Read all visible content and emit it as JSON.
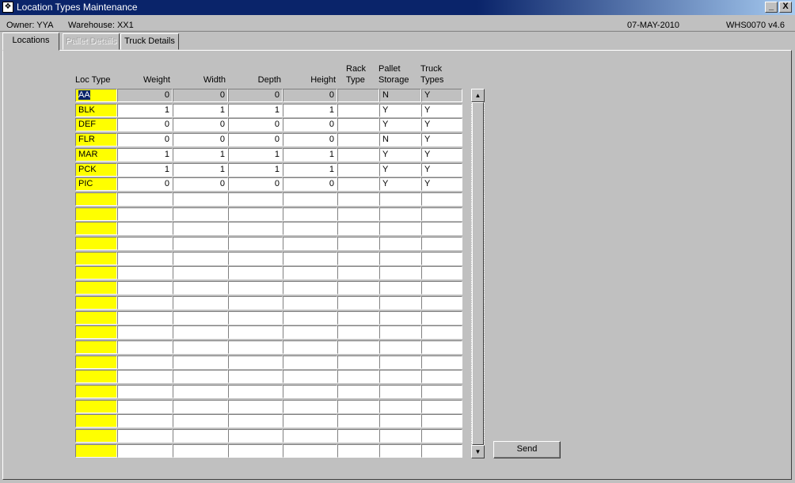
{
  "window": {
    "title": "Location Types Maintenance",
    "app_icon_text": "❖",
    "minimize_glyph": "_",
    "close_glyph": "X"
  },
  "info": {
    "owner": "Owner:  YYA",
    "warehouse": "Warehouse:  XX1",
    "date": "07-MAY-2010",
    "version": "WHS0070  v4.6"
  },
  "tabs": [
    "Locations",
    "Pallet Details",
    "Truck Details"
  ],
  "table": {
    "headers": {
      "loc_type": "Loc Type",
      "weight": "Weight",
      "width": "Width",
      "depth": "Depth",
      "height": "Height",
      "rack_type_1": "Rack",
      "rack_type_2": "Type",
      "pallet_storage_1": "Pallet",
      "pallet_storage_2": "Storage",
      "truck_types_1": "Truck",
      "truck_types_2": "Types"
    },
    "rows": [
      [
        "AA",
        "0",
        "0",
        "0",
        "0",
        "",
        "N",
        "Y"
      ],
      [
        "BLK",
        "1",
        "1",
        "1",
        "1",
        "",
        "Y",
        "Y"
      ],
      [
        "DEF",
        "0",
        "0",
        "0",
        "0",
        "",
        "Y",
        "Y"
      ],
      [
        "FLR",
        "0",
        "0",
        "0",
        "0",
        "",
        "N",
        "Y"
      ],
      [
        "MAR",
        "1",
        "1",
        "1",
        "1",
        "",
        "Y",
        "Y"
      ],
      [
        "PCK",
        "1",
        "1",
        "1",
        "1",
        "",
        "Y",
        "Y"
      ],
      [
        "PIC",
        "0",
        "0",
        "0",
        "0",
        "",
        "Y",
        "Y"
      ],
      [
        "",
        "",
        "",
        "",
        "",
        "",
        "",
        ""
      ],
      [
        "",
        "",
        "",
        "",
        "",
        "",
        "",
        ""
      ],
      [
        "",
        "",
        "",
        "",
        "",
        "",
        "",
        ""
      ],
      [
        "",
        "",
        "",
        "",
        "",
        "",
        "",
        ""
      ],
      [
        "",
        "",
        "",
        "",
        "",
        "",
        "",
        ""
      ],
      [
        "",
        "",
        "",
        "",
        "",
        "",
        "",
        ""
      ],
      [
        "",
        "",
        "",
        "",
        "",
        "",
        "",
        ""
      ],
      [
        "",
        "",
        "",
        "",
        "",
        "",
        "",
        ""
      ],
      [
        "",
        "",
        "",
        "",
        "",
        "",
        "",
        ""
      ],
      [
        "",
        "",
        "",
        "",
        "",
        "",
        "",
        ""
      ],
      [
        "",
        "",
        "",
        "",
        "",
        "",
        "",
        ""
      ],
      [
        "",
        "",
        "",
        "",
        "",
        "",
        "",
        ""
      ],
      [
        "",
        "",
        "",
        "",
        "",
        "",
        "",
        ""
      ],
      [
        "",
        "",
        "",
        "",
        "",
        "",
        "",
        ""
      ],
      [
        "",
        "",
        "",
        "",
        "",
        "",
        "",
        ""
      ],
      [
        "",
        "",
        "",
        "",
        "",
        "",
        "",
        ""
      ],
      [
        "",
        "",
        "",
        "",
        "",
        "",
        "",
        ""
      ],
      [
        "",
        "",
        "",
        "",
        "",
        "",
        "",
        ""
      ]
    ],
    "selected_row": 0
  },
  "scrollbar": {
    "up_glyph": "▲",
    "down_glyph": "▼"
  },
  "buttons": {
    "send": "Send"
  },
  "colors": {
    "background": "#c0c0c0",
    "title_bar": "#0a246a",
    "loc_field": "#ffff00",
    "selection": "#0a246a"
  }
}
